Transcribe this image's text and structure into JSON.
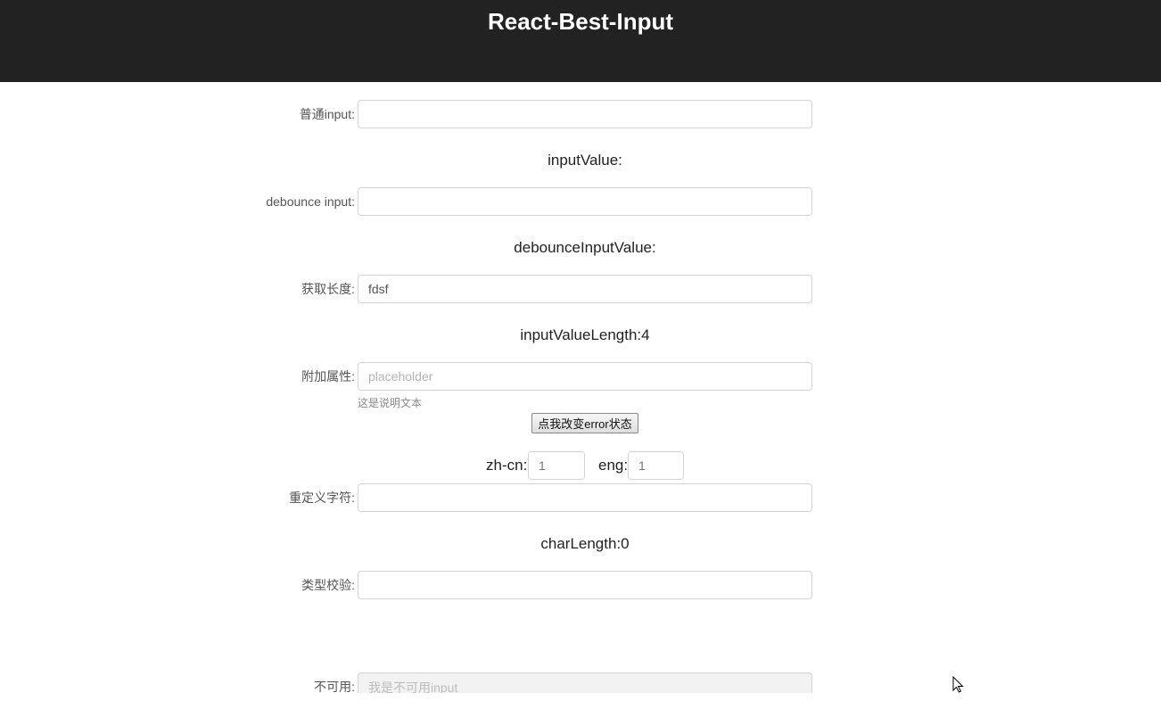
{
  "header": {
    "title": "React-Best-Input"
  },
  "fields": {
    "normal": {
      "label": "普通input:",
      "value": "",
      "placeholder": ""
    },
    "debounce": {
      "label": "debounce input:",
      "value": "",
      "placeholder": ""
    },
    "length": {
      "label": "获取长度:",
      "value": "fdsf",
      "placeholder": ""
    },
    "extra": {
      "label": "附加属性:",
      "value": "",
      "placeholder": "placeholder",
      "help": "这是说明文本"
    },
    "charset": {
      "label": "重定义字符:",
      "value": "",
      "placeholder": ""
    },
    "type_check": {
      "label": "类型校验:",
      "value": "",
      "placeholder": ""
    },
    "disabled": {
      "label": "不可用:",
      "value": "",
      "placeholder": "我是不可用input"
    }
  },
  "values": {
    "input_value": "inputValue:",
    "debounce_value": "debounceInputValue:",
    "input_value_length": "inputValueLength:4",
    "char_length": "charLength:0"
  },
  "error_button": {
    "label": "点我改变error状态"
  },
  "char_weights": {
    "zh_label": "zh-cn:",
    "zh_value": "1",
    "eng_label": "eng:",
    "eng_value": "1"
  },
  "icons": {
    "cursor": "mouse-pointer-icon"
  }
}
